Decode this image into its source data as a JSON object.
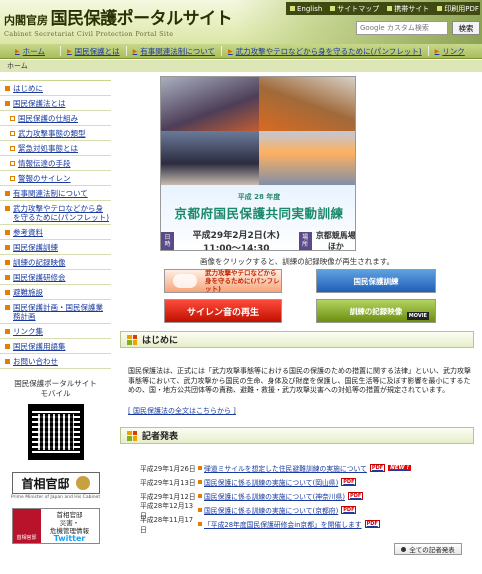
{
  "header": {
    "org": "内閣官房",
    "site_title": "国民保護ポータルサイト",
    "site_subtitle": "Cabinet Secretariat Civil Protection Portal Site",
    "util_links": [
      {
        "label": "English"
      },
      {
        "label": "サイトマップ"
      },
      {
        "label": "携帯サイト"
      },
      {
        "label": "印刷用PDF"
      }
    ],
    "search_placeholder": "Google カスタム検索",
    "search_button": "検索"
  },
  "nav": {
    "items": [
      {
        "label": "ホーム"
      },
      {
        "label": "国民保護とは"
      },
      {
        "label": "有事関連法制について"
      },
      {
        "label": "武力攻撃やテロなどから身を守るために(パンフレット)"
      },
      {
        "label": "リンク"
      }
    ]
  },
  "breadcrumb": "ホーム",
  "sidebar": {
    "items": [
      {
        "label": "はじめに",
        "level": 0
      },
      {
        "label": "国民保護法とは",
        "level": 0
      },
      {
        "label": "国民保護の仕組み",
        "level": 1
      },
      {
        "label": "武力攻撃事態の類型",
        "level": 1
      },
      {
        "label": "緊急対処事態とは",
        "level": 1
      },
      {
        "label": "情報伝達の手段",
        "level": 1
      },
      {
        "label": "警報のサイレン",
        "level": 1
      },
      {
        "label": "有事関連法制について",
        "level": 0
      },
      {
        "label": "武力攻撃やテロなどから身を守るために(パンフレット)",
        "level": 0
      },
      {
        "label": "参考資料",
        "level": 0
      },
      {
        "label": "国民保護訓練",
        "level": 0
      },
      {
        "label": "訓練の記録映像",
        "level": 0
      },
      {
        "label": "国民保護研修会",
        "level": 0
      },
      {
        "label": "避難施設",
        "level": 0
      },
      {
        "label": "国民保護計画・国民保護業務計画",
        "level": 0
      },
      {
        "label": "リンク集",
        "level": 0
      },
      {
        "label": "国民保護用語集",
        "level": 0
      },
      {
        "label": "お問い合わせ",
        "level": 0
      }
    ],
    "mobile_label": "国民保護ポータルサイト\nモバイル",
    "kantei_label": "首相官邸",
    "kantei_en": "Prime Minister of Japan and His Cabinet",
    "twitter": {
      "left_label": "首相官邸",
      "line1": "首相官邸",
      "line2": "災害・",
      "line3": "危機管理情報",
      "tw": "Twitter"
    }
  },
  "banner": {
    "year": "平成 28 年度",
    "title": "京都府国民保護共同実動訓練",
    "date_tag": "日時",
    "date": "平成29年2月2日(木) 11:00～14:30",
    "venue_tag": "場所",
    "venue": "京都競馬場ほか",
    "caption": "画像をクリックすると、訓練の記録映像が再生されます。"
  },
  "quick_buttons": {
    "pamphlet": "武力攻撃やテロなどから\n身を守るために(パンフレット)",
    "drill": "国民保護訓練",
    "siren": "サイレン音の再生",
    "video": "訓練の記録映像",
    "video_tag": "MOVIE"
  },
  "intro": {
    "heading": "はじめに",
    "body": "国民保護法は、正式には「武力攻撃事態等における国民の保護のための措置に関する法律」といい、武力攻撃事態等において、武力攻撃から国民の生命、身体及び財産を保護し、国民生活等に及ぼす影響を最小にするための、国・地方公共団体等の責務、避難・救援・武力攻撃災害への対処等の措置が規定されています。",
    "link": "[ 国民保護法の全文はこちらから ]"
  },
  "press": {
    "heading": "記者発表",
    "items": [
      {
        "date": "平成29年1月26日",
        "title": "弾道ミサイルを想定した住民避難訓練の実施について",
        "pdf": "PDF",
        "new": "NEW !"
      },
      {
        "date": "平成29年1月13日",
        "title": "国民保護に係る訓練の実施について(岡山県)",
        "pdf": "PDF"
      },
      {
        "date": "平成29年1月12日",
        "title": "国民保護に係る訓練の実施について(神奈川県)",
        "pdf": "PDF"
      },
      {
        "date": "平成28年12月13日",
        "title": "国民保護に係る訓練の実施について(京都府)",
        "pdf": "PDF"
      },
      {
        "date": "平成28年11月17日",
        "title": "「平成28年度国民保護研修会in京都」を開催します",
        "pdf": "PDF"
      }
    ],
    "all_label": "全ての記者発表"
  }
}
